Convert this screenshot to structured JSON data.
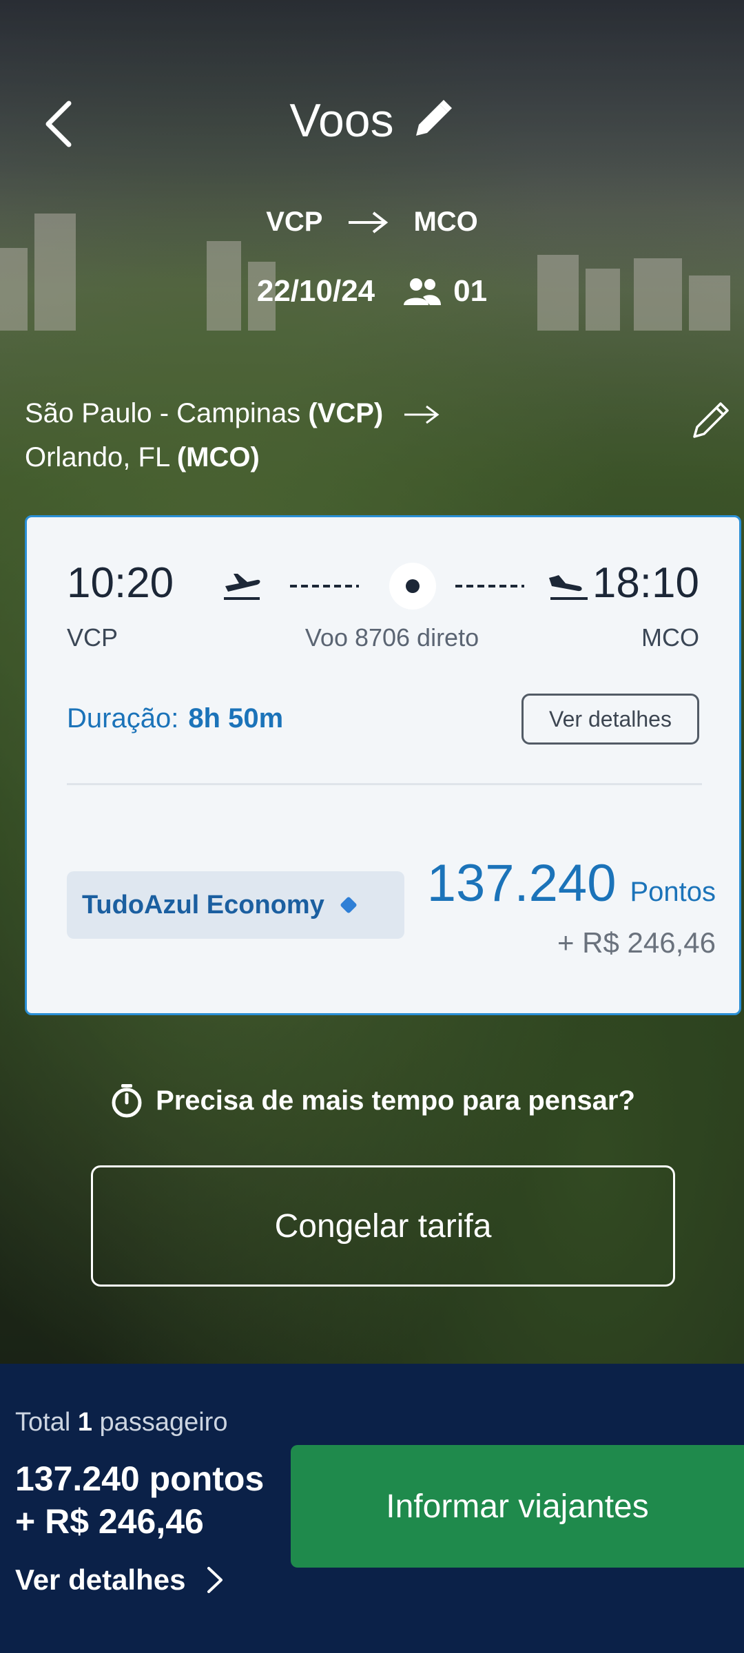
{
  "header": {
    "title": "Voos",
    "origin_code": "VCP",
    "destination_code": "MCO",
    "date": "22/10/24",
    "passengers": "01"
  },
  "route_summary": {
    "origin_city": "São Paulo - Campinas",
    "origin_code": "(VCP)",
    "destination_city": "Orlando, FL",
    "destination_code": "(MCO)"
  },
  "flight": {
    "departure_time": "10:20",
    "arrival_time": "18:10",
    "departure_code": "VCP",
    "arrival_code": "MCO",
    "flight_info": "Voo 8706 direto",
    "duration_label": "Duração:",
    "duration_value": "8h 50m",
    "details_button": "Ver detalhes",
    "fare_name": "TudoAzul Economy",
    "points_value": "137.240",
    "points_unit": "Pontos",
    "cash_addon": "+ R$ 246,46"
  },
  "freeze": {
    "question": "Precisa de mais tempo para pensar?",
    "button": "Congelar tarifa"
  },
  "footer": {
    "total_prefix": "Total",
    "total_count": "1",
    "total_suffix": "passageiro",
    "total_points": "137.240 pontos",
    "total_cash": "+ R$ 246,46",
    "details_link": "Ver detalhes",
    "cta": "Informar viajantes"
  },
  "colors": {
    "accent_blue": "#1b73b9",
    "card_border": "#2a8fd6",
    "footer_bg": "#0b2148",
    "cta_green": "#1f8a4c"
  },
  "icons": [
    "back-chevron-icon",
    "pencil-icon",
    "arrow-right-icon",
    "people-icon",
    "takeoff-icon",
    "landing-icon",
    "diamond-icon",
    "stopwatch-icon",
    "chevron-right-icon"
  ]
}
